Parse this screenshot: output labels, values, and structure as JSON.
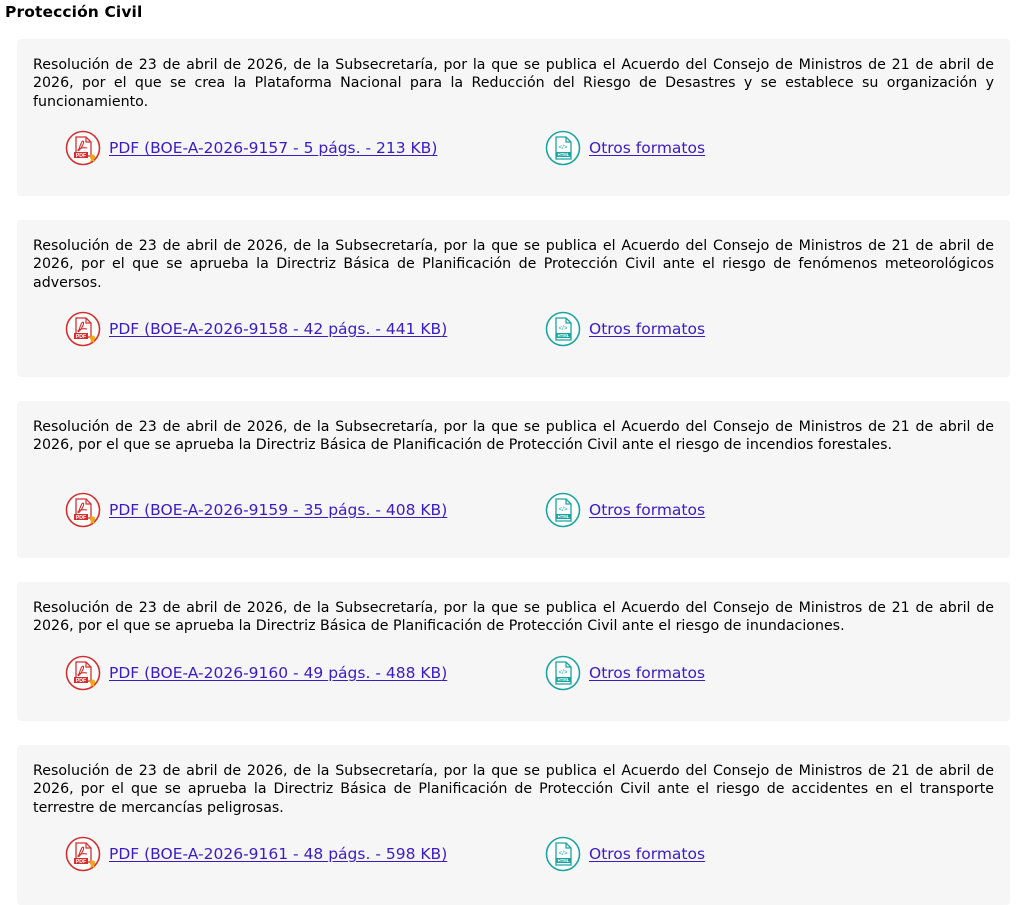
{
  "section": {
    "title": "Protección Civil"
  },
  "colors": {
    "background": "#ffffff",
    "card": "#f6f6f6",
    "link": "#3b1cc4",
    "pdf_icon": "#d32f2f",
    "html_icon": "#1aa3a0"
  },
  "entries": [
    {
      "text": "Resolución de 23 de abril de 2026, de la Subsecretaría, por la que se publica el Acuerdo del Consejo de Ministros de 21 de abril de 2026, por el que se crea la Plataforma Nacional para la Reducción del Riesgo de Desastres y se establece su organización y funcionamiento.",
      "pdf": {
        "pre": "PDF (BOE-A-2026-9157 - 5 ",
        "pags": "págs.",
        "mid": " - 213 ",
        "kb": "KB",
        "post": ")"
      },
      "other_formats": "Otros formatos"
    },
    {
      "text": "Resolución de 23 de abril de 2026, de la Subsecretaría, por la que se publica el Acuerdo del Consejo de Ministros de 21 de abril de 2026, por el que se aprueba la Directriz Básica de Planificación de Protección Civil ante el riesgo de fenómenos meteorológicos adversos.",
      "pdf": {
        "pre": "PDF (BOE-A-2026-9158 - 42 ",
        "pags": "págs.",
        "mid": " - 441 ",
        "kb": "KB",
        "post": ")"
      },
      "other_formats": "Otros formatos"
    },
    {
      "text": "Resolución de 23 de abril de 2026, de la Subsecretaría, por la que se publica el Acuerdo del Consejo de Ministros de 21 de abril de 2026, por el que se aprueba la Directriz Básica de Planificación de Protección Civil ante el riesgo de incendios forestales.",
      "pdf": {
        "pre": "PDF (BOE-A-2026-9159 - 35 ",
        "pags": "págs.",
        "mid": " - 408 ",
        "kb": "KB",
        "post": ")"
      },
      "other_formats": "Otros formatos"
    },
    {
      "text": "Resolución de 23 de abril de 2026, de la Subsecretaría, por la que se publica el Acuerdo del Consejo de Ministros de 21 de abril de 2026, por el que se aprueba la Directriz Básica de Planificación de Protección Civil ante el riesgo de inundaciones.",
      "pdf": {
        "pre": "PDF (BOE-A-2026-9160 - 49 ",
        "pags": "págs.",
        "mid": " - 488 ",
        "kb": "KB",
        "post": ")"
      },
      "other_formats": "Otros formatos"
    },
    {
      "text": "Resolución de 23 de abril de 2026, de la Subsecretaría, por la que se publica el Acuerdo del Consejo de Ministros de 21 de abril de 2026, por el que se aprueba la Directriz Básica de Planificación de Protección Civil ante el riesgo de accidentes en el transporte terrestre de mercancías peligrosas.",
      "pdf": {
        "pre": "PDF (BOE-A-2026-9161 - 48 ",
        "pags": "págs.",
        "mid": " - 598 ",
        "kb": "KB",
        "post": ")"
      },
      "other_formats": "Otros formatos"
    }
  ],
  "icons": {
    "pdf": "pdf-file-icon",
    "html": "html-file-icon"
  }
}
